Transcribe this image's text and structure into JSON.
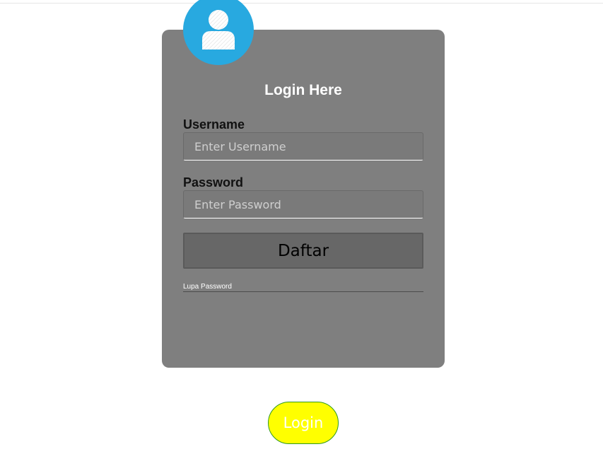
{
  "login_box": {
    "title": "Login Here",
    "username": {
      "label": "Username",
      "placeholder": "Enter Username"
    },
    "password": {
      "label": "Password",
      "placeholder": "Enter Password"
    },
    "register_button_label": "Daftar",
    "forgot_password_link": "Lupa Password"
  },
  "login_button_label": "Login",
  "icons": {
    "avatar": "user-avatar-icon"
  },
  "colors": {
    "card_background": "#7f7f7f",
    "avatar_background": "#28a9e0",
    "login_button_background": "#ffff00",
    "login_button_border": "#2e9a1f"
  }
}
